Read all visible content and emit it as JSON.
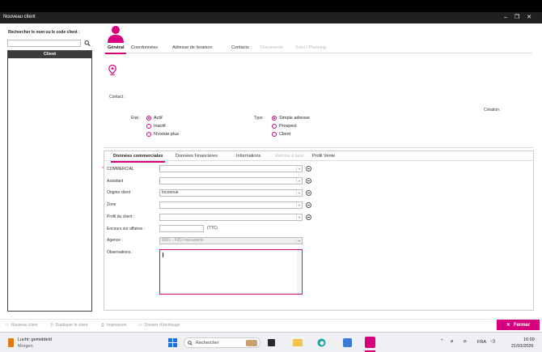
{
  "window": {
    "title": "Nouveau client"
  },
  "left_panel": {
    "search_label": "Rechercher le nom ou le code client :",
    "search_value": "",
    "list_header": "Client"
  },
  "tabs": [
    {
      "label": "Général",
      "state": "active"
    },
    {
      "label": "Coordonnées",
      "state": "normal"
    },
    {
      "label": "Adresse de livraison",
      "state": "normal"
    },
    {
      "label": "Contacts",
      "state": "normal"
    },
    {
      "label": "Documents",
      "state": "disabled"
    },
    {
      "label": "Suivi / Planning",
      "state": "disabled"
    }
  ],
  "general": {
    "contact_label": "Contact :",
    "creation_label": "Création :",
    "etat_label": "Etat :",
    "etat_options": [
      "Actif",
      "Inactif",
      "N'existe plus"
    ],
    "etat_selected": "Actif",
    "type_label": "Type :",
    "type_options": [
      "Simple adresse",
      "Prospect",
      "Client"
    ],
    "type_selected": "Simple adresse"
  },
  "subtabs": [
    {
      "label": "Données commerciales",
      "state": "active"
    },
    {
      "label": "Données Financières",
      "state": "normal"
    },
    {
      "label": "Informations",
      "state": "normal"
    },
    {
      "label": "Remise à faire",
      "state": "disabled"
    },
    {
      "label": "Profil Vente",
      "state": "normal"
    }
  ],
  "form": {
    "commercial_label": "COMMERCIAL",
    "commercial_marker": "*",
    "assistant_label": "Assistant",
    "origine_label": "Origine client",
    "origine_value": "Inconnue",
    "zone_label": "Zone",
    "profil_label": "Profil du client :",
    "encours_label": "Encours sur affaires :",
    "encours_value": "",
    "encours_unit": "(TTC)",
    "agence_label": "Agence :",
    "agence_value": "0001 - FDU menuiserie",
    "observations_label": "Observations :"
  },
  "actions": {
    "new_client": "Nouveau client",
    "show_client": "Dupliquer le client",
    "print": "Impression",
    "archive": "Dossier d'archivage",
    "close": "Fermer"
  },
  "taskbar": {
    "weather_title": "Lucht: gemiddeld",
    "weather_sub": "Morgen",
    "search_placeholder": "Rechercher",
    "lang": "FRA",
    "time": "16:09",
    "date": "21/01/2026"
  },
  "colors": {
    "accent": "#d6007e",
    "titlebar": "#202020",
    "list_header": "#3c3c3c"
  },
  "icons": [
    "search-icon",
    "person-icon",
    "location-pin-icon",
    "minus-circle-icon",
    "close-icon",
    "windows-start-icon",
    "edge-icon",
    "wifi-icon",
    "volume-icon",
    "battery-icon"
  ]
}
